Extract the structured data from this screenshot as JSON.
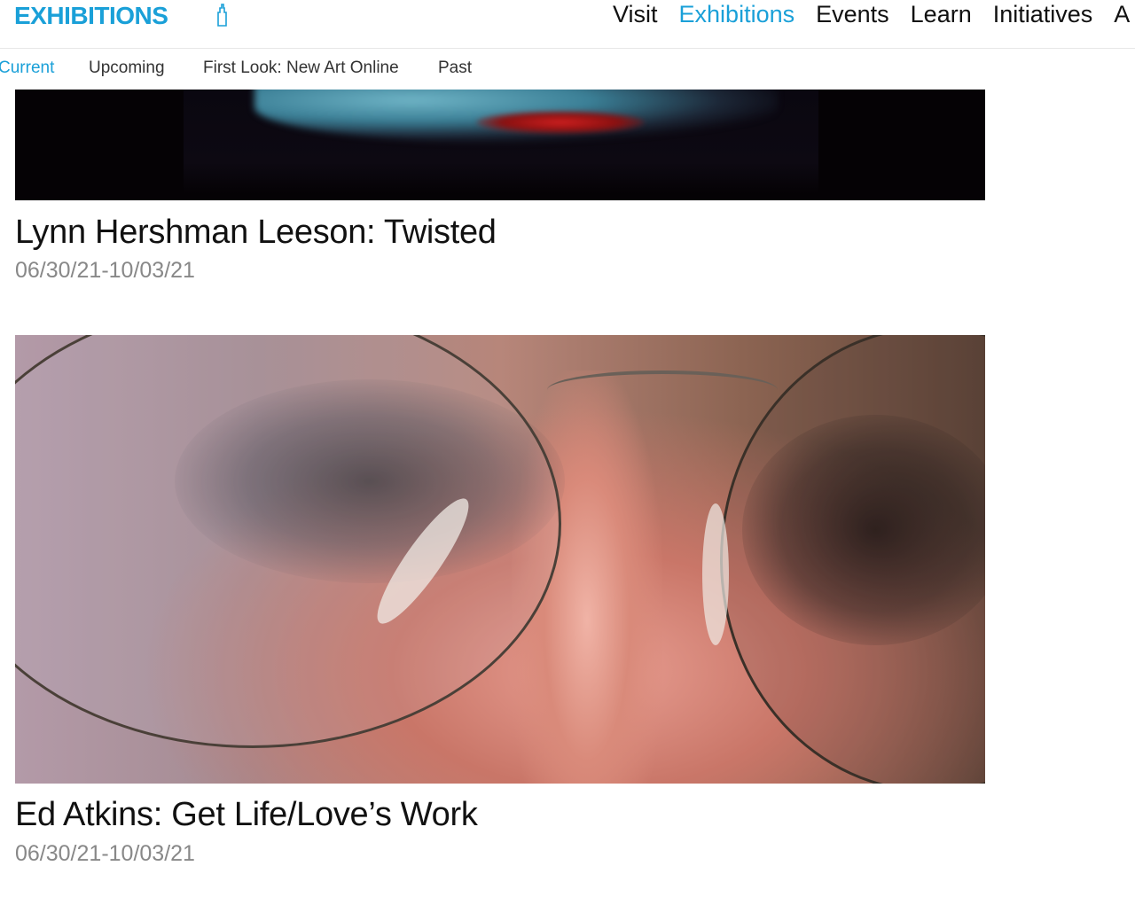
{
  "header": {
    "logo": "EXHIBITIONS",
    "logo_icon": "building-icon",
    "accent_color": "#1aa0d8",
    "nav": [
      "Visit",
      "Exhibitions",
      "Events",
      "Learn",
      "Initiatives",
      "A"
    ],
    "active_nav": "Exhibitions"
  },
  "subnav": {
    "items": [
      "Current",
      "Upcoming",
      "First Look: New Art Online",
      "Past"
    ],
    "active": "Current"
  },
  "exhibitions": [
    {
      "title": "Lynn Hershman Leeson: Twisted",
      "dates": "06/30/21-10/03/21"
    },
    {
      "title": "Ed Atkins: Get Life/Love’s Work",
      "dates": "06/30/21-10/03/21"
    }
  ]
}
